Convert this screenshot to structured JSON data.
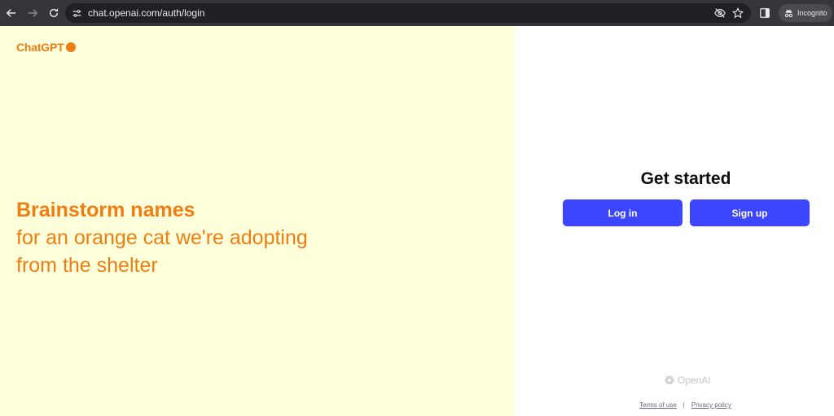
{
  "browser": {
    "url": "chat.openai.com/auth/login",
    "profile_label": "Incognito"
  },
  "hero": {
    "logo_text": "ChatGPT",
    "headline_bold": "Brainstorm names",
    "headline_line1": "for an orange cat we're adopting",
    "headline_line2": "from the shelter"
  },
  "auth": {
    "title": "Get started",
    "login_label": "Log in",
    "signup_label": "Sign up"
  },
  "footer": {
    "brand": "OpenAI",
    "terms_label": "Terms of use",
    "separator": "|",
    "privacy_label": "Privacy policy"
  },
  "colors": {
    "accent_orange": "#ef7d12",
    "left_bg": "#ffffdc",
    "button_blue": "#3c46ff"
  }
}
